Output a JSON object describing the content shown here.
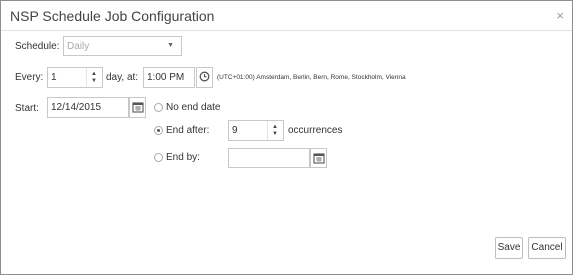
{
  "dialog": {
    "title": "NSP Schedule Job Configuration",
    "close_glyph": "×"
  },
  "schedule": {
    "label": "Schedule:",
    "value": "Daily"
  },
  "every": {
    "label": "Every:",
    "value": "1",
    "unit_label": "day, at:",
    "time": "1:00 PM",
    "timezone": "(UTC+01:00) Amsterdam, Berlin, Bern, Rome, Stockholm, Vienna"
  },
  "start": {
    "label": "Start:",
    "date": "12/14/2015"
  },
  "end_options": {
    "no_end": {
      "label": "No end date",
      "selected": false
    },
    "end_after": {
      "label": "End after:",
      "value": "9",
      "unit": "occurrences",
      "selected": true
    },
    "end_by": {
      "label": "End by:",
      "value": "",
      "selected": false
    }
  },
  "footer": {
    "save_label": "Save",
    "cancel_label": "Cancel"
  },
  "colors": {
    "border": "#8f8f8f",
    "input_border": "#c8c8c8",
    "text": "#333333"
  }
}
